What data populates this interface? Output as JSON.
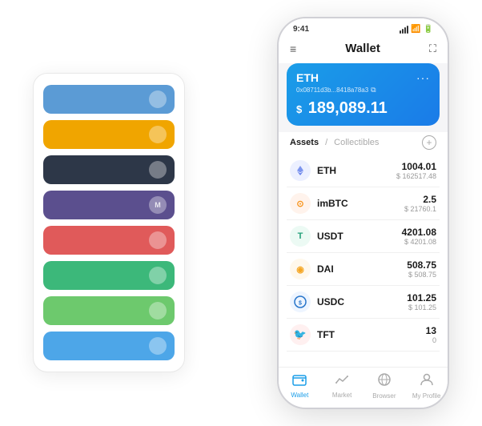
{
  "cardStack": {
    "items": [
      {
        "color": "ci-blue",
        "dot": ""
      },
      {
        "color": "ci-orange",
        "dot": ""
      },
      {
        "color": "ci-dark",
        "dot": ""
      },
      {
        "color": "ci-purple",
        "dot": "M"
      },
      {
        "color": "ci-red",
        "dot": ""
      },
      {
        "color": "ci-green",
        "dot": ""
      },
      {
        "color": "ci-lightgreen",
        "dot": ""
      },
      {
        "color": "ci-skyblue",
        "dot": ""
      }
    ]
  },
  "phone": {
    "statusBar": {
      "time": "9:41",
      "battery": "■"
    },
    "header": {
      "menuIcon": "≡",
      "title": "Wallet",
      "expandIcon": "⛶"
    },
    "ethCard": {
      "symbol": "ETH",
      "more": "···",
      "address": "0x08711d3b...8418a78a3",
      "balanceDollar": "$",
      "balance": "189,089.11"
    },
    "assets": {
      "activeTab": "Assets",
      "separator": "/",
      "inactiveTab": "Collectibles",
      "addLabel": "+"
    },
    "assetList": [
      {
        "name": "ETH",
        "amount": "1004.01",
        "usd": "$ 162517.48",
        "iconLabel": "◆",
        "iconClass": "icon-eth"
      },
      {
        "name": "imBTC",
        "amount": "2.5",
        "usd": "$ 21760.1",
        "iconLabel": "⊙",
        "iconClass": "icon-imbtc"
      },
      {
        "name": "USDT",
        "amount": "4201.08",
        "usd": "$ 4201.08",
        "iconLabel": "T",
        "iconClass": "icon-usdt"
      },
      {
        "name": "DAI",
        "amount": "508.75",
        "usd": "$ 508.75",
        "iconLabel": "◎",
        "iconClass": "icon-dai"
      },
      {
        "name": "USDC",
        "amount": "101.25",
        "usd": "$ 101.25",
        "iconLabel": "©",
        "iconClass": "icon-usdc"
      },
      {
        "name": "TFT",
        "amount": "13",
        "usd": "0",
        "iconLabel": "❤",
        "iconClass": "icon-tft"
      }
    ],
    "bottomNav": [
      {
        "label": "Wallet",
        "icon": "◉",
        "active": true
      },
      {
        "label": "Market",
        "icon": "📈",
        "active": false
      },
      {
        "label": "Browser",
        "icon": "⊕",
        "active": false
      },
      {
        "label": "My Profile",
        "icon": "👤",
        "active": false
      }
    ]
  }
}
